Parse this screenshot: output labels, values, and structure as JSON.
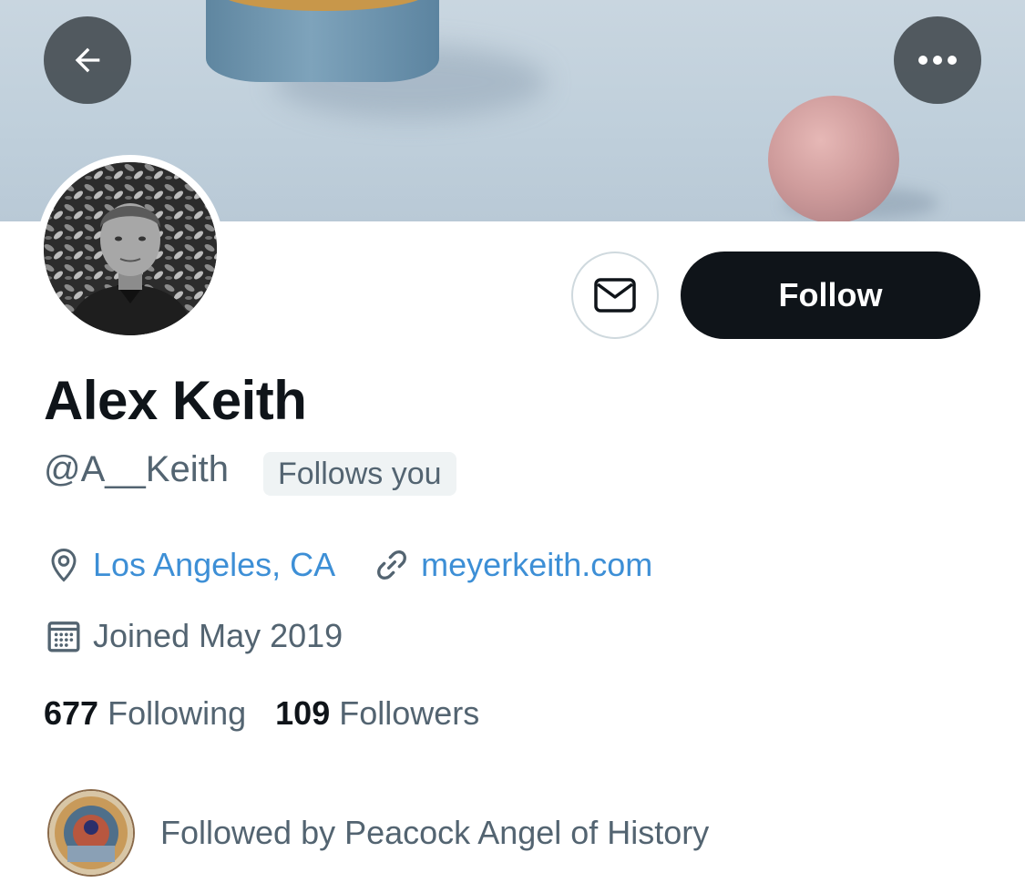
{
  "profile": {
    "name": "Alex Keith",
    "handle": "@A__Keith",
    "follows_you_badge": "Follows you",
    "location": "Los Angeles, CA",
    "website": "meyerkeith.com",
    "joined": "Joined May 2019",
    "following_count": "677",
    "following_label": "Following",
    "followers_count": "109",
    "followers_label": "Followers"
  },
  "actions": {
    "follow_label": "Follow",
    "back_icon": "arrow-left-icon",
    "more_icon": "more-horizontal-icon",
    "message_icon": "envelope-icon"
  },
  "followed_by": {
    "text": "Followed by Peacock Angel of History"
  },
  "colors": {
    "link": "#3d8fd6",
    "follow_button_bg": "#0f1419",
    "secondary_text": "#536471",
    "badge_bg": "#eff3f4"
  }
}
